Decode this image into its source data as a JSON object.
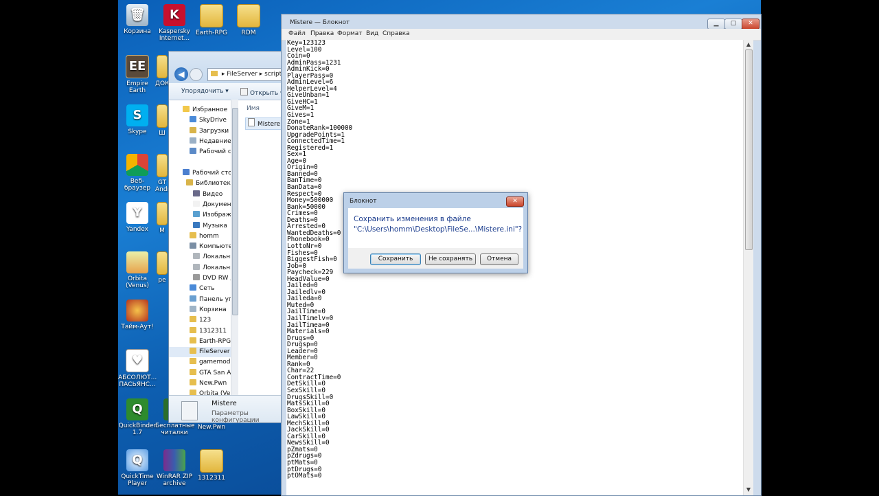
{
  "desktop": {
    "icons": [
      {
        "label": "Корзина",
        "glyph": "🗑"
      },
      {
        "label": "Kaspersky Internet...",
        "glyph": "K"
      },
      {
        "label": "Earth-RPG",
        "glyph": ""
      },
      {
        "label": "RDM",
        "glyph": ""
      },
      {
        "label": "Empire Earth",
        "glyph": "EE"
      },
      {
        "label": "ДОК",
        "glyph": ""
      },
      {
        "label": "Skype",
        "glyph": "S"
      },
      {
        "label": "Ш",
        "glyph": ""
      },
      {
        "label": "Веб-браузер",
        "glyph": ""
      },
      {
        "label": "GT Andr",
        "glyph": ""
      },
      {
        "label": "Yandex",
        "glyph": "Y"
      },
      {
        "label": "M",
        "glyph": ""
      },
      {
        "label": "Orbita (Venus)",
        "glyph": ""
      },
      {
        "label": "ре",
        "glyph": ""
      },
      {
        "label": "Тайм-Аут!",
        "glyph": ""
      },
      {
        "label": "АБСОЛЮТ... ПАСЬЯНС...",
        "glyph": "♥"
      },
      {
        "label": "QuickBinder 1.7",
        "glyph": "Q"
      },
      {
        "label": "Бесплатные читалки",
        "glyph": ""
      },
      {
        "label": "New.Pwn",
        "glyph": ""
      },
      {
        "label": "QuickTime Player",
        "glyph": "Q"
      },
      {
        "label": "WinRAR ZIP archive",
        "glyph": ""
      },
      {
        "label": "1312311",
        "glyph": ""
      }
    ]
  },
  "explorer": {
    "address": [
      "FileServer",
      "scripts"
    ],
    "toolbar": {
      "organize": "Упорядочить ▾",
      "open": "Открыть ▾"
    },
    "tree": [
      "Избранное",
      "SkyDrive",
      "Загрузки",
      "Недавние м",
      "Рабочий ст",
      "Рабочий сто",
      "Библиотек",
      "Видео",
      "Докумен",
      "Изображ",
      "Музыка",
      "homm",
      "Компьютер",
      "Локальны",
      "Локальны",
      "DVD RW д",
      "Сеть",
      "Панель упр",
      "Корзина",
      "123",
      "1312311",
      "Earth-RPG",
      "FileServer",
      "gamemode",
      "GTA San Ar",
      "New.Pwn",
      "Orbita (Ven"
    ],
    "column_name": "Имя",
    "file": "Mistere",
    "details": {
      "name": "Mistere",
      "type": "Параметры конфигурации"
    }
  },
  "notepad": {
    "title": "Mistere — Блокнот",
    "menu": [
      "Файл",
      "Правка",
      "Формат",
      "Вид",
      "Справка"
    ],
    "content": "Key=123123\nLevel=100\nCoin=0\nAdminPass=1231\nAdminKick=0\nPlayerPass=0\nAdminLevel=6\nHelperLevel=4\nGiveUnban=1\nGiveHC=1\nGiveM=1\nGives=1\nZone=1\nDonateRank=100000\nUpgradePoints=1\nConnectedTime=1\nRegistered=1\nSex=1\nAge=0\nOrigin=0\nBanned=0\nBanTime=0\nBanData=0\nRespect=0\nMoney=500000\nBank=50000\nCrimes=0\nDeaths=0\nArrested=0\nWantedDeaths=0\nPhonebook=0\nLottoNr=0\nFishes=0\nBiggestFish=0\nJob=0\nPaycheck=229\nHeadValue=0\nJailed=0\nJailedlv=0\nJaileda=0\nMuted=0\nJailTime=0\nJailTimelv=0\nJailTimea=0\nMaterials=0\nDrugs=0\nDrugsp=0\nLeader=0\nMember=0\nRank=0\nChar=22\nContractTime=0\nDetSkill=0\nSexSkill=0\nDrugsSkill=0\nMatsSkill=0\nBoxSkill=0\nLawSkill=0\nMechSkill=0\nJackSkill=0\nCarSkill=0\nNewsSkill=0\npZmats=0\npZdrugs=0\nptMats=0\nptDrugs=0\nptOMats=0"
  },
  "dialog": {
    "title": "Блокнот",
    "message_line1": "Сохранить изменения в файле",
    "message_line2": "\"C:\\Users\\homm\\Desktop\\FileSe...\\Mistere.ini\"?",
    "buttons": {
      "save": "Сохранить",
      "dont_save": "Не сохранять",
      "cancel": "Отмена"
    }
  }
}
